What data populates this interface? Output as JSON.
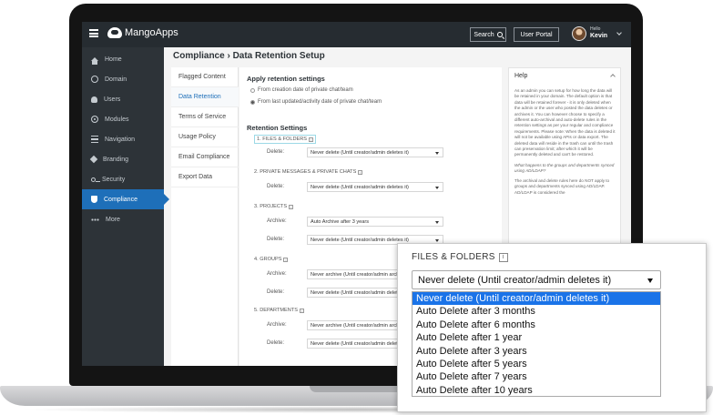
{
  "app": {
    "logo_text": "MangoApps",
    "search_label": "Search",
    "user_portal_label": "User Portal",
    "hello_label": "Hello",
    "user_name": "Kevin"
  },
  "sidebar": {
    "items": [
      {
        "label": "Home",
        "icon": "home-icon"
      },
      {
        "label": "Domain",
        "icon": "globe-icon"
      },
      {
        "label": "Users",
        "icon": "users-icon"
      },
      {
        "label": "Modules",
        "icon": "modules-icon"
      },
      {
        "label": "Navigation",
        "icon": "navigation-icon"
      },
      {
        "label": "Branding",
        "icon": "branding-icon"
      },
      {
        "label": "Security",
        "icon": "key-icon"
      },
      {
        "label": "Compliance",
        "icon": "shield-icon",
        "active": true
      },
      {
        "label": "More",
        "icon": "more-icon"
      }
    ]
  },
  "page": {
    "title": "Compliance › Data Retention Setup"
  },
  "subnav": {
    "items": [
      {
        "label": "Flagged Content"
      },
      {
        "label": "Data Retention",
        "active": true
      },
      {
        "label": "Terms of Service"
      },
      {
        "label": "Usage Policy"
      },
      {
        "label": "Email Compliance"
      },
      {
        "label": "Export Data"
      }
    ]
  },
  "retention": {
    "apply_heading": "Apply retention settings",
    "option_creation": "From creation date of private chat/team",
    "option_updated": "From last updated/activity date of private chat/team",
    "settings_heading": "Retention Settings",
    "info_glyph": "i",
    "categories": {
      "files": {
        "label": "1. FILES & FOLDERS",
        "field": "Delete:",
        "value": "Never delete (Until creator/admin deletes it)"
      },
      "messages": {
        "label": "2. PRIVATE MESSAGES & PRIVATE CHATS",
        "field": "Delete:",
        "value": "Never delete (Until creator/admin deletes it)"
      },
      "projects": {
        "label": "3. PROJECTS",
        "archive_field": "Archive:",
        "archive_value": "Auto Archive after 3 years",
        "field": "Delete:",
        "value": "Never delete (Until creator/admin deletes it)"
      },
      "groups": {
        "label": "4. GROUPS",
        "archive_field": "Archive:",
        "archive_value": "Never archive (Until creator/admin archives it)",
        "field": "Delete:",
        "value": "Never delete (Until creator/admin deletes it)"
      },
      "departments": {
        "label": "5. DEPARTMENTS",
        "archive_field": "Archive:",
        "archive_value": "Never archive (Until creator/admin archives it)",
        "field": "Delete:",
        "value": "Never delete (Until creator/admin deletes it)"
      }
    }
  },
  "help": {
    "title": "Help",
    "body": "As an admin you can setup for how long the data will be retained in your domain. The default option is that data will be retained forever - it is only deleted when the admin or the user who posted the data deletes or archives it. You can however choose to specify a different auto-archival and auto-delete rules in the retention settings as per your regular and compliance requirements. Please note: When the data is deleted it will not be available using APIs or data export. The deleted data will reside in the trash can until the trash can preservation limit; after which it will be permanently deleted and can't be restored.",
    "question": "What happens to the groups and departments synced using AD/LDAP?",
    "answer": "The archival and delete rules here do NOT apply to groups and departments synced using AD/LDAP. AD/LDAP is considered the"
  },
  "dropdown": {
    "title": "FILES & FOLDERS",
    "info_glyph": "i",
    "selected": "Never delete (Until creator/admin deletes it)",
    "options": [
      "Never delete (Until creator/admin deletes it)",
      "Auto Delete after 3 months",
      "Auto Delete after 6 months",
      "Auto Delete after 1 year",
      "Auto Delete after 3 years",
      "Auto Delete after 5 years",
      "Auto Delete after 7 years",
      "Auto Delete after 10 years"
    ],
    "highlight_color": "#1a73e8"
  },
  "colors": {
    "sidebar_bg": "#2d3338",
    "header_bg": "#262c31",
    "accent": "#1e6fb9"
  }
}
